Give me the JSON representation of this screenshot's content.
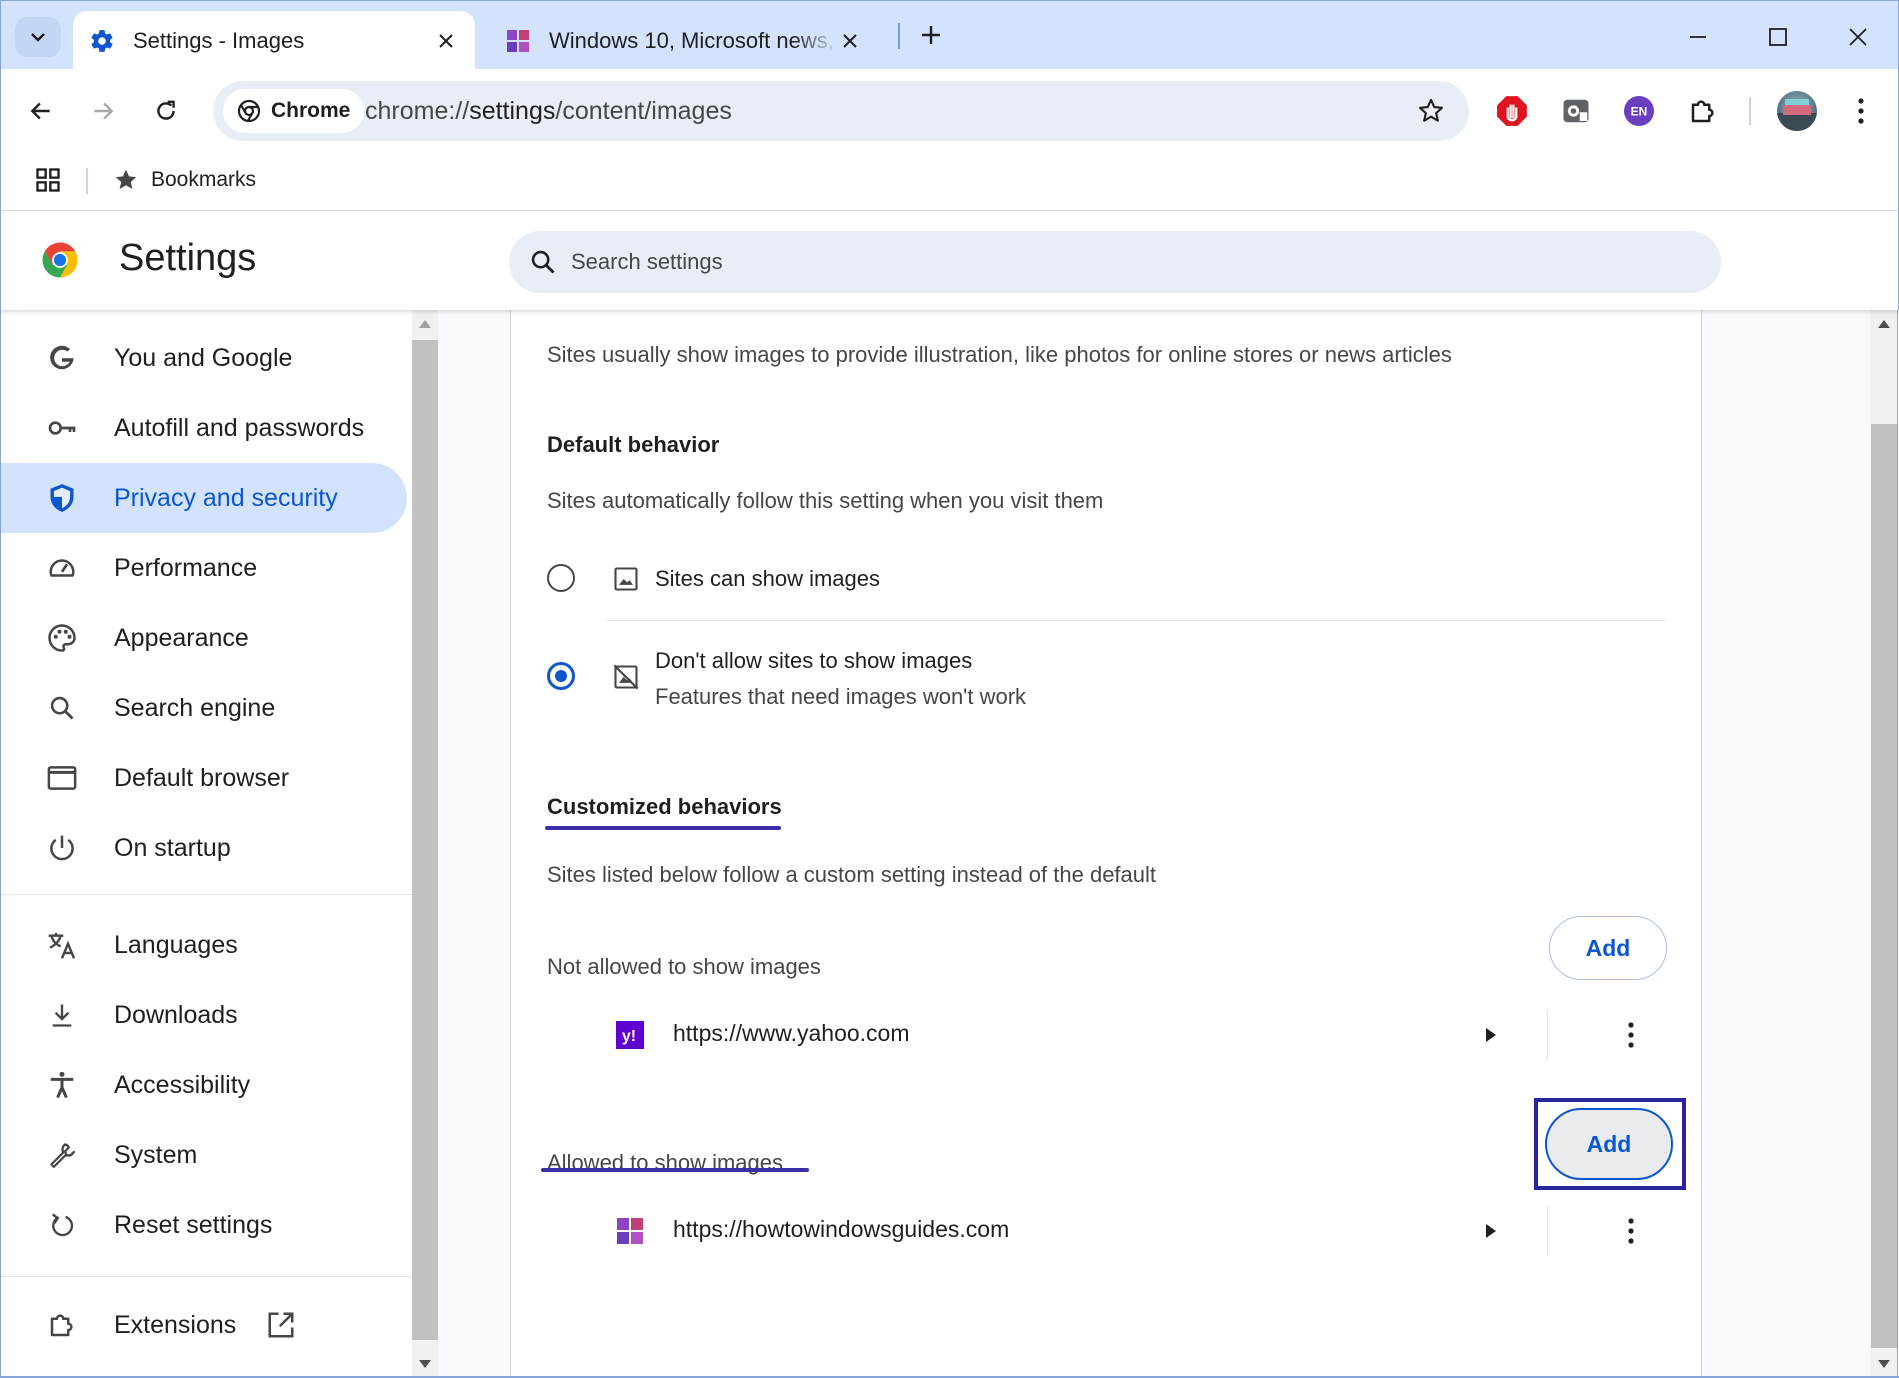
{
  "tabs": [
    {
      "title": "Settings - Images",
      "favicon": "gear-icon",
      "active": true
    },
    {
      "title": "Windows 10, Microsoft news, d",
      "favicon": "windows-tiles-icon",
      "active": false
    }
  ],
  "toolbar": {
    "chip_label": "Chrome",
    "url_scheme": "chrome://",
    "url_host": "settings",
    "url_path": "/content/images",
    "extensions": [
      "adblock-icon",
      "screenshot-extension-icon",
      "language-en-icon",
      "puzzle-extensions-icon"
    ],
    "lang_badge": "EN"
  },
  "bookmarks_bar": {
    "item_label": "Bookmarks"
  },
  "header": {
    "title": "Settings",
    "search_placeholder": "Search settings"
  },
  "sidebar": {
    "items": [
      {
        "label": "You and Google",
        "icon": "google-g-icon"
      },
      {
        "label": "Autofill and passwords",
        "icon": "key-icon"
      },
      {
        "label": "Privacy and security",
        "icon": "shield-icon",
        "selected": true
      },
      {
        "label": "Performance",
        "icon": "speedometer-icon"
      },
      {
        "label": "Appearance",
        "icon": "palette-icon"
      },
      {
        "label": "Search engine",
        "icon": "search-icon"
      },
      {
        "label": "Default browser",
        "icon": "browser-window-icon"
      },
      {
        "label": "On startup",
        "icon": "power-icon"
      },
      {
        "label": "Languages",
        "icon": "translate-icon"
      },
      {
        "label": "Downloads",
        "icon": "download-icon"
      },
      {
        "label": "Accessibility",
        "icon": "accessibility-icon"
      },
      {
        "label": "System",
        "icon": "wrench-icon"
      },
      {
        "label": "Reset settings",
        "icon": "reset-icon"
      },
      {
        "label": "Extensions",
        "icon": "puzzle-icon",
        "trailing_icon": "open-external-icon"
      }
    ]
  },
  "content": {
    "intro": "Sites usually show images to provide illustration, like photos for online stores or news articles",
    "default_heading": "Default behavior",
    "default_desc": "Sites automatically follow this setting when you visit them",
    "options": [
      {
        "label": "Sites can show images",
        "sublabel": "",
        "checked": false,
        "icon": "image-icon"
      },
      {
        "label": "Don't allow sites to show images",
        "sublabel": "Features that need images won't work",
        "checked": true,
        "icon": "image-off-icon"
      }
    ],
    "custom_heading": "Customized behaviors",
    "custom_desc": "Sites listed below follow a custom setting instead of the default",
    "not_allowed": {
      "label": "Not allowed to show images",
      "add_label": "Add",
      "sites": [
        {
          "url": "https://www.yahoo.com",
          "favicon": "yahoo-icon"
        }
      ]
    },
    "allowed": {
      "label": "Allowed to show images",
      "add_label": "Add",
      "sites": [
        {
          "url": "https://howtowindowsguides.com",
          "favicon": "windows-tiles-icon"
        }
      ]
    }
  },
  "colors": {
    "accent": "#0b57d0",
    "selected_bg": "#d3e3fd",
    "tabstrip_bg": "#d3e3fd",
    "annotation": "#2b24a1"
  }
}
